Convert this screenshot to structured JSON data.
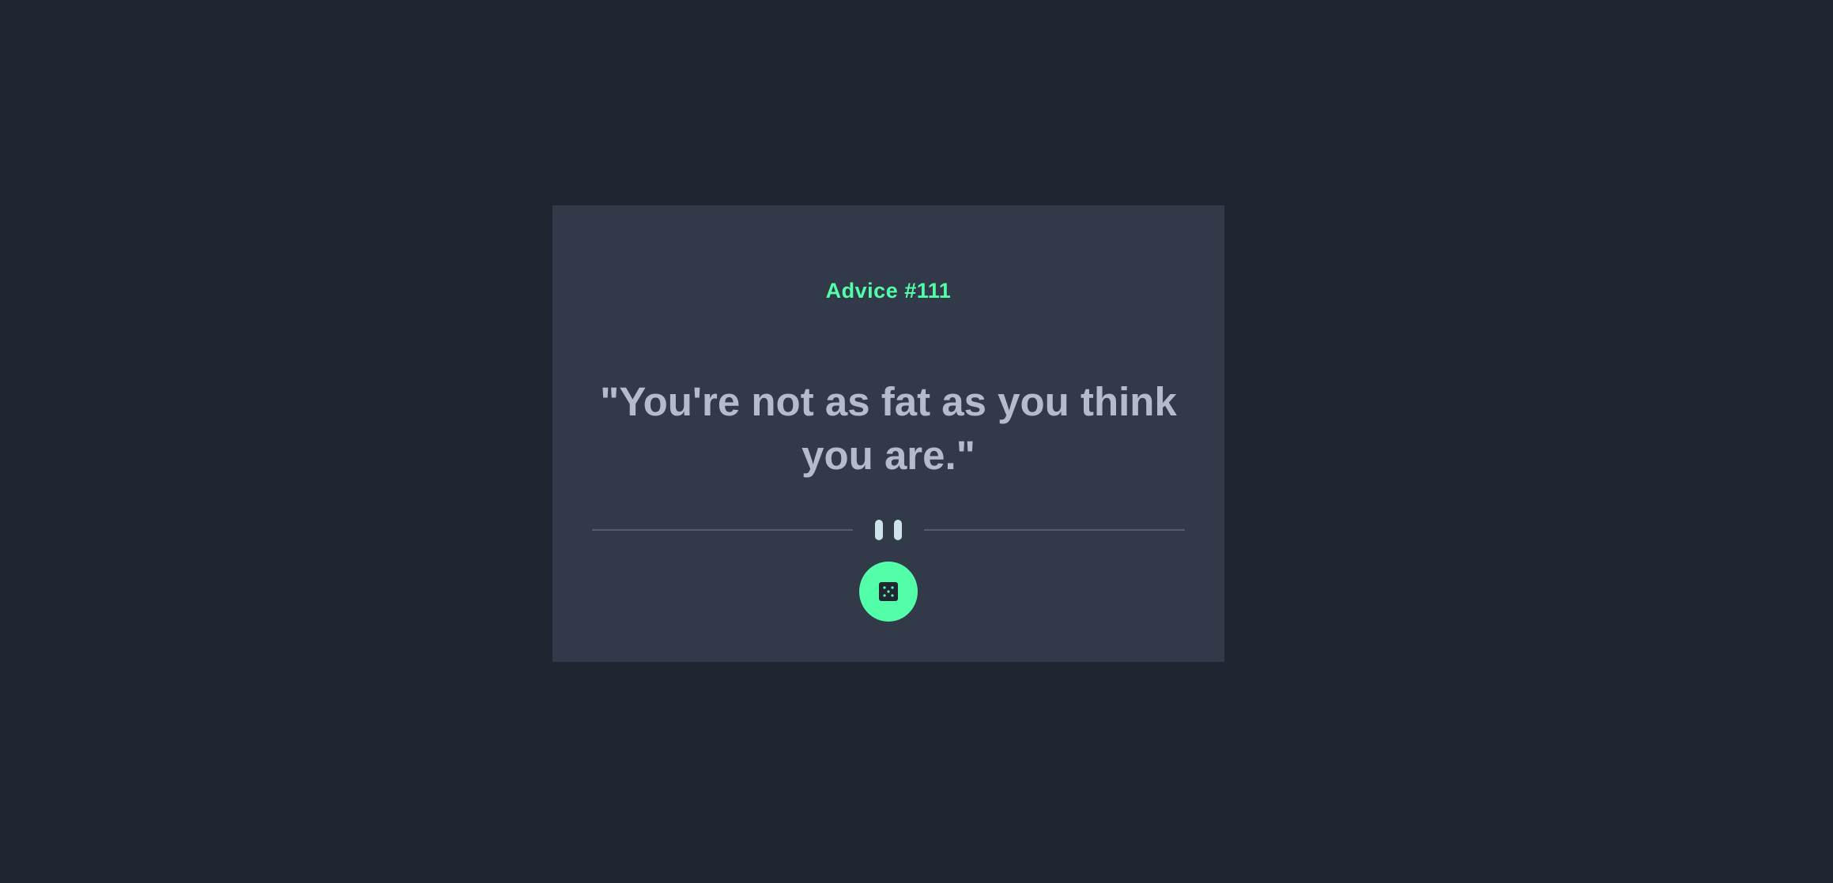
{
  "card": {
    "advice_label": "Advice #111",
    "quote": "\"You're not as fat as you think you are.\""
  },
  "icons": {
    "divider": "pause-icon",
    "button": "dice-icon"
  },
  "colors": {
    "background": "#1f2531",
    "card": "#323a4a",
    "accent": "#52ffa8",
    "quote_text": "#cfd9e7",
    "divider_line": "#4f5d73"
  }
}
